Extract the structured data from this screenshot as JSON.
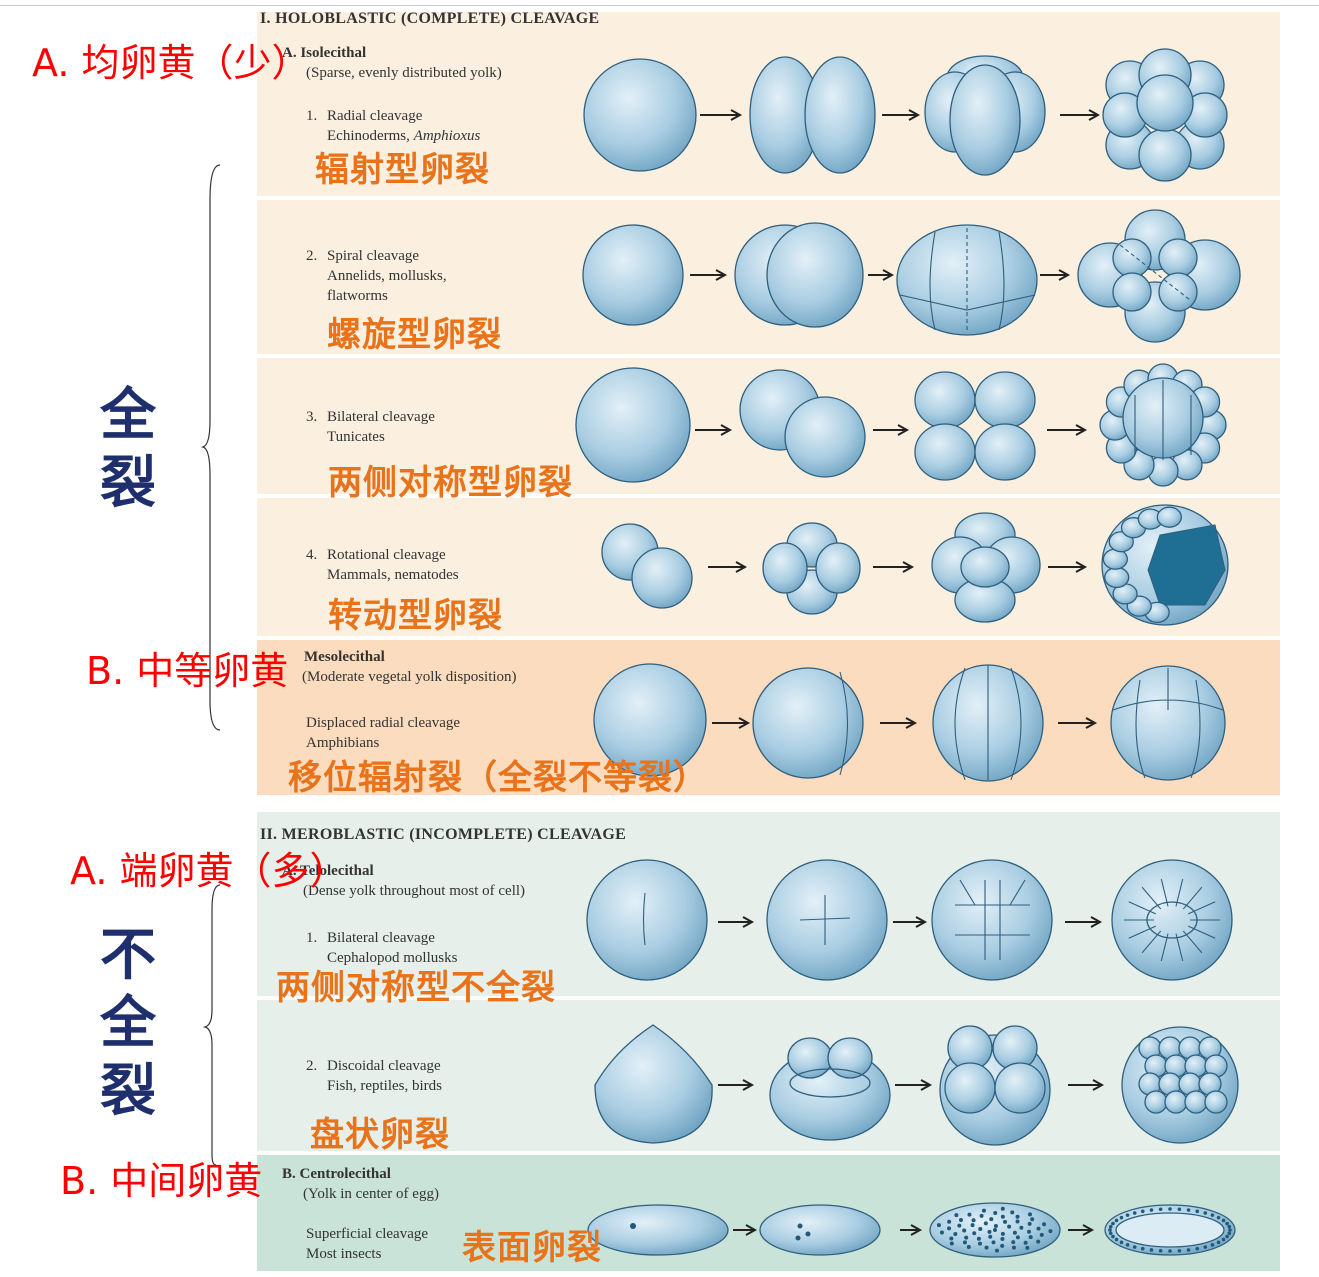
{
  "colors": {
    "band_holo": "#fbf0e0",
    "band_meso": "#fbdcbe",
    "band_mero": "#e6efea",
    "band_centro": "#c9e3d8",
    "annotation_red": "#ff0000",
    "annotation_orange": "#e8731a",
    "annotation_navy": "#1f2f6e",
    "cell_stroke": "#2e5f7e"
  },
  "section1": {
    "heading": "I. HOLOBLASTIC (COMPLETE) CLEAVAGE",
    "A": {
      "title": "A. Isolecithal",
      "desc": "(Sparse, evenly distributed yolk)"
    },
    "rows": [
      {
        "num": "1.",
        "name": "Radial cleavage",
        "organisms": "Echinoderms, ",
        "organisms_italic": "Amphioxus",
        "cn": "辐射型卵裂"
      },
      {
        "num": "2.",
        "name": "Spiral cleavage",
        "organisms": "Annelids, mollusks,",
        "organisms2": "flatworms",
        "cn": "螺旋型卵裂"
      },
      {
        "num": "3.",
        "name": "Bilateral cleavage",
        "organisms": "Tunicates",
        "cn": "两侧对称型卵裂"
      },
      {
        "num": "4.",
        "name": "Rotational cleavage",
        "organisms": "Mammals, nematodes",
        "cn": "转动型卵裂"
      }
    ],
    "B": {
      "title": "Mesolecithal",
      "desc": "(Moderate vegetal yolk disposition)",
      "name": "Displaced radial cleavage",
      "organisms": "Amphibians",
      "cn": "移位辐射裂（全裂不等裂）"
    }
  },
  "section2": {
    "heading": "II. MEROBLASTIC (INCOMPLETE) CLEAVAGE",
    "A": {
      "title": "A. Telolecithal",
      "desc": "(Dense yolk throughout most of cell)"
    },
    "rows": [
      {
        "num": "1.",
        "name": "Bilateral cleavage",
        "organisms": "Cephalopod mollusks",
        "cn": "两侧对称型不全裂"
      },
      {
        "num": "2.",
        "name": "Discoidal cleavage",
        "organisms": "Fish, reptiles, birds",
        "cn": "盘状卵裂"
      }
    ],
    "B": {
      "title": "B.  Centrolecithal",
      "desc": "(Yolk in center of egg)",
      "name": "Superficial cleavage",
      "organisms": "Most insects",
      "cn": "表面卵裂"
    }
  },
  "annotations": {
    "iso": "A. 均卵黄（少）",
    "meso": "B. 中等卵黄",
    "telo": "A. 端卵黄（多）",
    "centro": "B. 中间卵黄",
    "holo_group": "全裂",
    "mero_group": "不全裂"
  }
}
